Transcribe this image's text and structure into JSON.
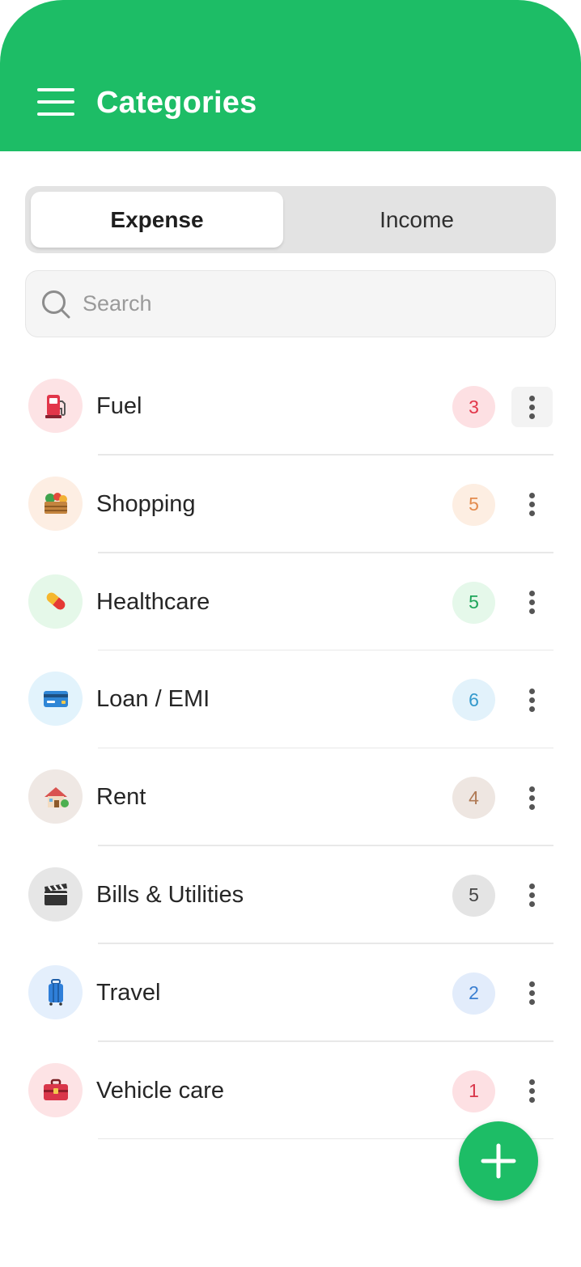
{
  "header": {
    "title": "Categories",
    "menu_icon": "hamburger-menu-icon",
    "color": "#1dbd66"
  },
  "tabs": [
    {
      "label": "Expense",
      "active": true
    },
    {
      "label": "Income",
      "active": false
    }
  ],
  "search": {
    "placeholder": "Search",
    "value": "",
    "icon": "search-icon"
  },
  "categories": [
    {
      "name": "Fuel",
      "count": "3",
      "icon": "fuel-pump-icon",
      "icon_bg": "#fde3e5",
      "badge_bg": "#fde0e3",
      "badge_color": "#e2364a"
    },
    {
      "name": "Shopping",
      "count": "5",
      "icon": "produce-crate-icon",
      "icon_bg": "#fdeee3",
      "badge_bg": "#fdeee2",
      "badge_color": "#e38b4d"
    },
    {
      "name": "Healthcare",
      "count": "5",
      "icon": "pill-icon",
      "icon_bg": "#e5f8e9",
      "badge_bg": "#e5f8ea",
      "badge_color": "#1ea55a"
    },
    {
      "name": "Loan / EMI",
      "count": "6",
      "icon": "credit-card-icon",
      "icon_bg": "#e2f3fc",
      "badge_bg": "#e2f2fb",
      "badge_color": "#3399cc"
    },
    {
      "name": "Rent",
      "count": "4",
      "icon": "house-icon",
      "icon_bg": "#efe8e4",
      "badge_bg": "#eee6e1",
      "badge_color": "#b07a55"
    },
    {
      "name": "Bills & Utilities",
      "count": "5",
      "icon": "clapperboard-icon",
      "icon_bg": "#e6e6e6",
      "badge_bg": "#e4e4e4",
      "badge_color": "#444444"
    },
    {
      "name": "Travel",
      "count": "2",
      "icon": "luggage-icon",
      "icon_bg": "#e4effc",
      "badge_bg": "#e2ecfb",
      "badge_color": "#3b7fd1"
    },
    {
      "name": "Vehicle care",
      "count": "1",
      "icon": "toolbox-icon",
      "icon_bg": "#fde3e5",
      "badge_bg": "#fde0e3",
      "badge_color": "#d9364a"
    }
  ],
  "fab": {
    "icon": "plus-icon"
  }
}
